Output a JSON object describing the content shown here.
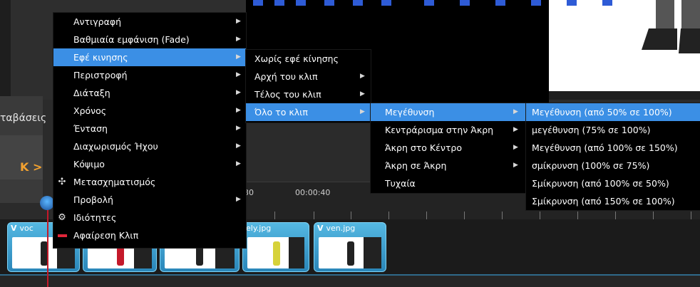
{
  "background": {
    "panel_label": "ταβάσεις",
    "nav_arrows": "K  >",
    "timeline_labels": [
      "30",
      "00:00:40"
    ],
    "clips": [
      {
        "title": "voc"
      },
      {
        "title": ""
      },
      {
        "title": ""
      },
      {
        "title": "ely.jpg"
      },
      {
        "title": "ven.jpg"
      }
    ],
    "clip_marker": "V"
  },
  "menu_main": {
    "items": [
      {
        "label": "Αντιγραφή",
        "submenu": true
      },
      {
        "label": "Βαθμιαία εμφάνιση (Fade)",
        "submenu": true
      },
      {
        "label": "Εφέ κινησης",
        "submenu": true,
        "highlighted": true
      },
      {
        "label": "Περιστροφή",
        "submenu": true
      },
      {
        "label": "Διάταξη",
        "submenu": true
      },
      {
        "label": "Χρόνος",
        "submenu": true
      },
      {
        "label": "Ένταση",
        "submenu": true
      },
      {
        "label": "Διαχωρισμός Ήχου",
        "submenu": true
      },
      {
        "label": "Κόψιμο",
        "submenu": true
      },
      {
        "label": "Μετασχηματισμός",
        "submenu": false,
        "icon": "move-icon"
      },
      {
        "label": "Προβολή",
        "submenu": true
      },
      {
        "label": "Ιδιότητες",
        "submenu": false,
        "icon": "gear-icon"
      },
      {
        "label": "Αφαίρεση Κλιπ",
        "submenu": false,
        "icon": "remove-icon"
      }
    ]
  },
  "menu_motion": {
    "items": [
      {
        "label": "Χωρίς εφέ κίνησης",
        "submenu": false
      },
      {
        "label": "Αρχή του κλιπ",
        "submenu": true
      },
      {
        "label": "Τέλος του κλιπ",
        "submenu": true
      },
      {
        "label": "Όλο το κλιπ",
        "submenu": true,
        "highlighted": true
      }
    ]
  },
  "menu_whole": {
    "items": [
      {
        "label": "Μεγέθυνση",
        "submenu": true,
        "highlighted": true
      },
      {
        "label": "Κεντράρισμα στην Άκρη",
        "submenu": true
      },
      {
        "label": "Άκρη στο Κέντρο",
        "submenu": true
      },
      {
        "label": "Άκρη σε Άκρη",
        "submenu": true
      },
      {
        "label": "Τυχαία",
        "submenu": false
      }
    ]
  },
  "menu_zoom": {
    "items": [
      {
        "label": "Μεγέθυνση (από 50% σε 100%)",
        "highlighted": true
      },
      {
        "label": "μεγέθυνση (75% σε 100%)"
      },
      {
        "label": "Μεγέθυνση (από 100% σε 150%)"
      },
      {
        "label": "σμίκρυνση (100% σε 75%)"
      },
      {
        "label": "Σμίκρυνση (από 100% σε 50%)"
      },
      {
        "label": "Σμίκρυνση (από 150% σε 100%)"
      }
    ]
  },
  "colors": {
    "menu_bg": "#000000",
    "highlight": "#3b8fe5",
    "clip": "#3fa3d4",
    "playhead": "#c4192a"
  }
}
